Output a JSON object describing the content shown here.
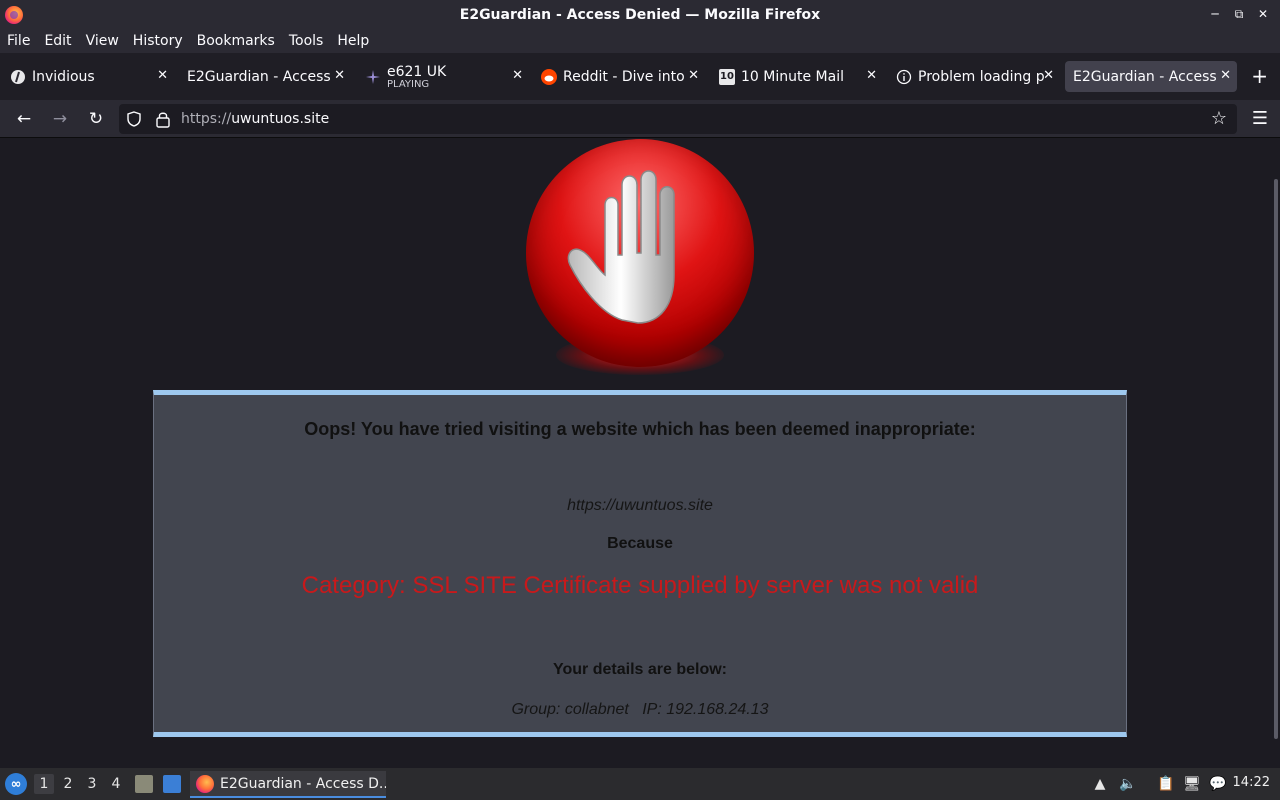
{
  "window": {
    "title": "E2Guardian - Access Denied — Mozilla Firefox"
  },
  "menu": [
    "File",
    "Edit",
    "View",
    "History",
    "Bookmarks",
    "Tools",
    "Help"
  ],
  "tabs": [
    {
      "label": "Invidious",
      "icon": "invidious-icon"
    },
    {
      "label": "E2Guardian - Access",
      "icon": "none"
    },
    {
      "label": "e621 UK",
      "sub": "PLAYING",
      "icon": "e621-icon"
    },
    {
      "label": "Reddit - Dive into",
      "icon": "reddit-icon"
    },
    {
      "label": "10 Minute Mail",
      "icon": "10minutemail-icon"
    },
    {
      "label": "Problem loading p",
      "icon": "info-icon"
    },
    {
      "label": "E2Guardian - Access",
      "icon": "none",
      "active": true
    }
  ],
  "urlbar": {
    "protocol": "https://",
    "host": "uwuntuos.site"
  },
  "page": {
    "heading": "Oops! You have tried visiting a website which has been deemed inappropriate:",
    "blocked_url": "https://uwuntuos.site",
    "because": "Because",
    "reason": "Category: SSL SITE  Certificate supplied by server was not valid",
    "details_label": "Your details are below:",
    "details": "Group: collabnet   IP: 192.168.24.13"
  },
  "taskbar": {
    "workspaces": [
      "1",
      "2",
      "3",
      "4"
    ],
    "active_task": "E2Guardian - Access D...",
    "clock": "14:22"
  },
  "colors": {
    "reason": "#c8191b",
    "box_border": "#9ec8ef",
    "box_bg": "#42454f"
  }
}
